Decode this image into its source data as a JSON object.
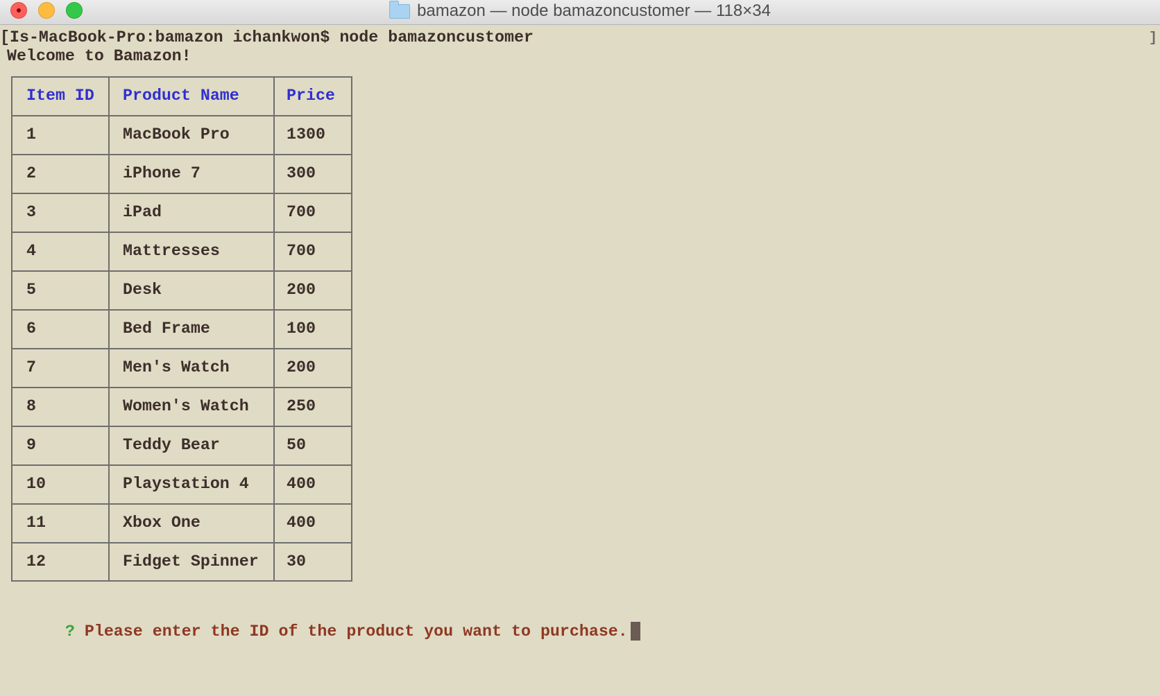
{
  "window": {
    "title": "bamazon — node bamazoncustomer — 118×34",
    "folder_icon": "folder-icon"
  },
  "terminal": {
    "command_line": "[Is-MacBook-Pro:bamazon ichankwon$ node bamazoncustomer",
    "right_bracket": "]",
    "welcome": "Welcome to Bamazon!",
    "table": {
      "headers": [
        "Item ID",
        "Product Name",
        "Price"
      ],
      "rows": [
        [
          "1",
          "MacBook Pro",
          "1300"
        ],
        [
          "2",
          "iPhone 7",
          "300"
        ],
        [
          "3",
          "iPad",
          "700"
        ],
        [
          "4",
          "Mattresses",
          "700"
        ],
        [
          "5",
          "Desk",
          "200"
        ],
        [
          "6",
          "Bed Frame",
          "100"
        ],
        [
          "7",
          "Men's Watch",
          "200"
        ],
        [
          "8",
          "Women's Watch",
          "250"
        ],
        [
          "9",
          "Teddy Bear",
          "50"
        ],
        [
          "10",
          "Playstation 4",
          "400"
        ],
        [
          "11",
          "Xbox One",
          "400"
        ],
        [
          "12",
          "Fidget Spinner",
          "30"
        ]
      ]
    },
    "prompt_mark": "?",
    "prompt_text": "Please enter the ID of the product you want to purchase.",
    "colors": {
      "background": "#e0dbc5",
      "text": "#3c2f2a",
      "header": "#2f2fd0",
      "prompt_mark": "#3aa53a",
      "prompt_text": "#8e3822"
    }
  }
}
